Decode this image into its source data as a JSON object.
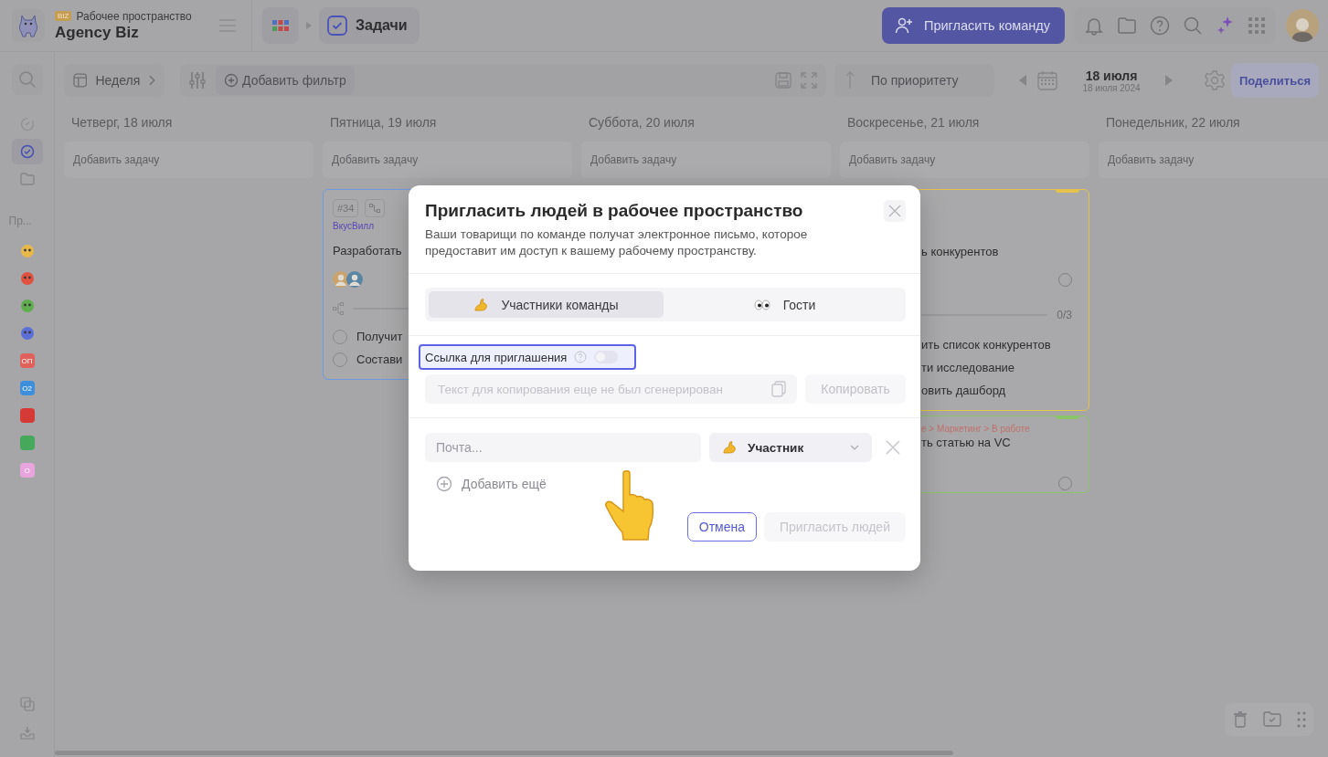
{
  "workspace": {
    "badge": "BIZ",
    "label": "Рабочее пространство",
    "name": "Agency Biz"
  },
  "breadcrumb": {
    "current": "Задачи"
  },
  "header": {
    "invite_button": "Пригласить команду"
  },
  "toolbar": {
    "view": "Неделя",
    "add_filter": "Добавить фильтр",
    "sort": "По приоритету",
    "date": "18 июля",
    "date_sub": "18 июля 2024",
    "share": "Поделиться"
  },
  "sidebar": {
    "nav": [
      {
        "kind": "gauge",
        "selected": false
      },
      {
        "kind": "tasks",
        "selected": true
      },
      {
        "kind": "folder",
        "selected": false
      }
    ],
    "section_label": "Пр...",
    "projects": [
      {
        "kind": "picture",
        "color": "#e8b94a"
      },
      {
        "kind": "picture",
        "color": "#e0523f"
      },
      {
        "kind": "picture",
        "color": "#5fae4e"
      },
      {
        "kind": "picture",
        "color": "#5b6fd6"
      },
      {
        "kind": "label",
        "label": "ОП",
        "color": "#e0605c"
      },
      {
        "kind": "label",
        "label": "О2",
        "color": "#3d8fdc"
      },
      {
        "kind": "tile",
        "color": "#d63a36"
      },
      {
        "kind": "tile",
        "color": "#45a85a"
      },
      {
        "kind": "label",
        "label": "О",
        "color": "#e8a4dc"
      }
    ]
  },
  "columns": [
    {
      "title": "Четверг, 18 июля",
      "add_placeholder": "Добавить задачу"
    },
    {
      "title": "Пятница, 19 июля",
      "add_placeholder": "Добавить задачу",
      "cards": [
        {
          "color": "#6d9ae0",
          "tag": "#34",
          "project": "ВкусВилл",
          "title": "Разработать",
          "assignees": [
            {
              "color": "#c9a36b"
            },
            {
              "color": "#5a86a6"
            }
          ],
          "progress": {
            "level": 0
          },
          "subtasks": [
            {
              "text": "Получит",
              "checked": false
            },
            {
              "text": "Состави",
              "checked": false
            }
          ]
        }
      ]
    },
    {
      "title": "Суббота, 20 июля",
      "add_placeholder": "Добавить задачу"
    },
    {
      "title": "Воскресенье, 21 июля",
      "add_placeholder": "Добавить задачу",
      "cards": [
        {
          "color": "#e4c24c",
          "flag": true,
          "title": "ь конкурентов",
          "checked": false,
          "progress": {
            "level": 0,
            "count": "0/3"
          },
          "subtasks": [
            {
              "text": "ить список конкурентов"
            },
            {
              "text": "ти исследование"
            },
            {
              "text": "овить дашборд"
            }
          ]
        },
        {
          "color": "#8cc46a",
          "flag": true,
          "path": "е > Маркетинг > В работе",
          "title": "ть статью на VC",
          "checked": false
        }
      ]
    },
    {
      "title": "Понедельник, 22 июля",
      "add_placeholder": "Добавить задачу"
    }
  ],
  "modal": {
    "title": "Пригласить людей в рабочее пространство",
    "description": "Ваши товарищи по команде получат электронное письмо, которое предоставит им доступ к вашему рабочему пространству.",
    "tabs": [
      {
        "kind": "members",
        "label": "Участники команды",
        "selected": true
      },
      {
        "kind": "guests",
        "label": "Гости",
        "selected": false
      }
    ],
    "invite_link": {
      "label": "Ссылка для приглашения",
      "on": false,
      "placeholder": "Текст для копирования еще не был сгенерирован",
      "copy_button": "Копировать"
    },
    "email": {
      "placeholder": "Почта..."
    },
    "role": {
      "value": "Участник"
    },
    "add_more": "Добавить ещё",
    "cancel": "Отмена",
    "submit": {
      "label": "Пригласить людей",
      "disabled": true
    }
  }
}
